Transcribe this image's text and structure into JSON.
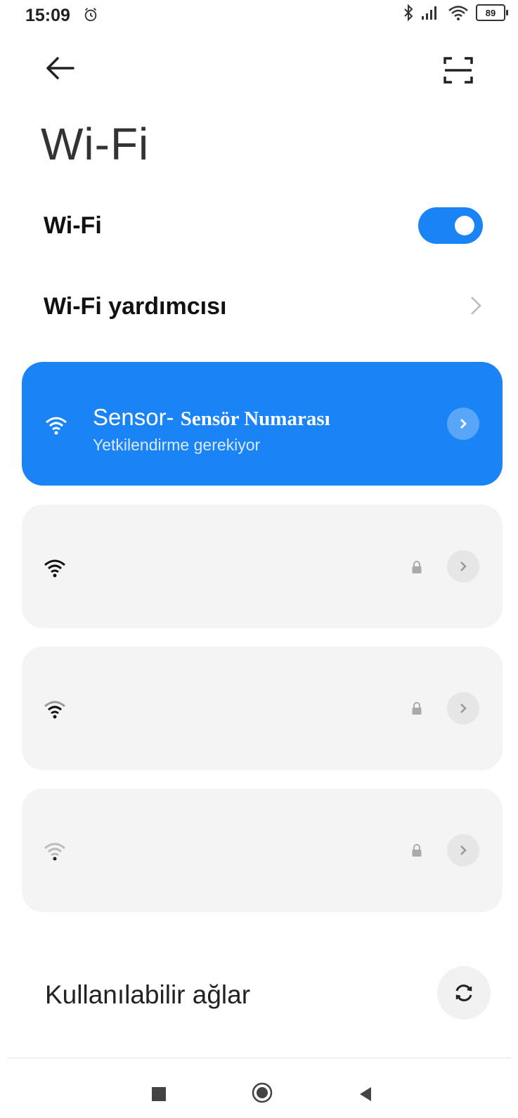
{
  "status_bar": {
    "time": "15:09",
    "battery": "89",
    "icons": [
      "alarm-icon",
      "bluetooth-icon",
      "signal-icon",
      "wifi-icon",
      "battery-icon"
    ]
  },
  "header": {
    "title": "Wi-Fi",
    "back_icon": "arrow-left-icon",
    "scan_icon": "scan-icon"
  },
  "wifi_toggle": {
    "label": "Wi-Fi",
    "state": "on",
    "color": "#1a83f5"
  },
  "assistant": {
    "label": "Wi-Fi yardımcısı"
  },
  "connected_network": {
    "name_prefix": "Sensor- ",
    "name_bold": "Sensör Numarası",
    "status": "Yetkilendirme gerekiyor",
    "card_color": "#1a83f5"
  },
  "networks": [
    {
      "name": "",
      "secured": true,
      "signal": "strong"
    },
    {
      "name": "",
      "secured": true,
      "signal": "medium"
    },
    {
      "name": "",
      "secured": true,
      "signal": "weak"
    }
  ],
  "available_networks": {
    "label": "Kullanılabilir ağlar",
    "refresh_icon": "refresh-icon"
  },
  "nav_bar": {
    "icons": [
      "recents-icon",
      "home-icon",
      "back-triangle-icon"
    ]
  }
}
